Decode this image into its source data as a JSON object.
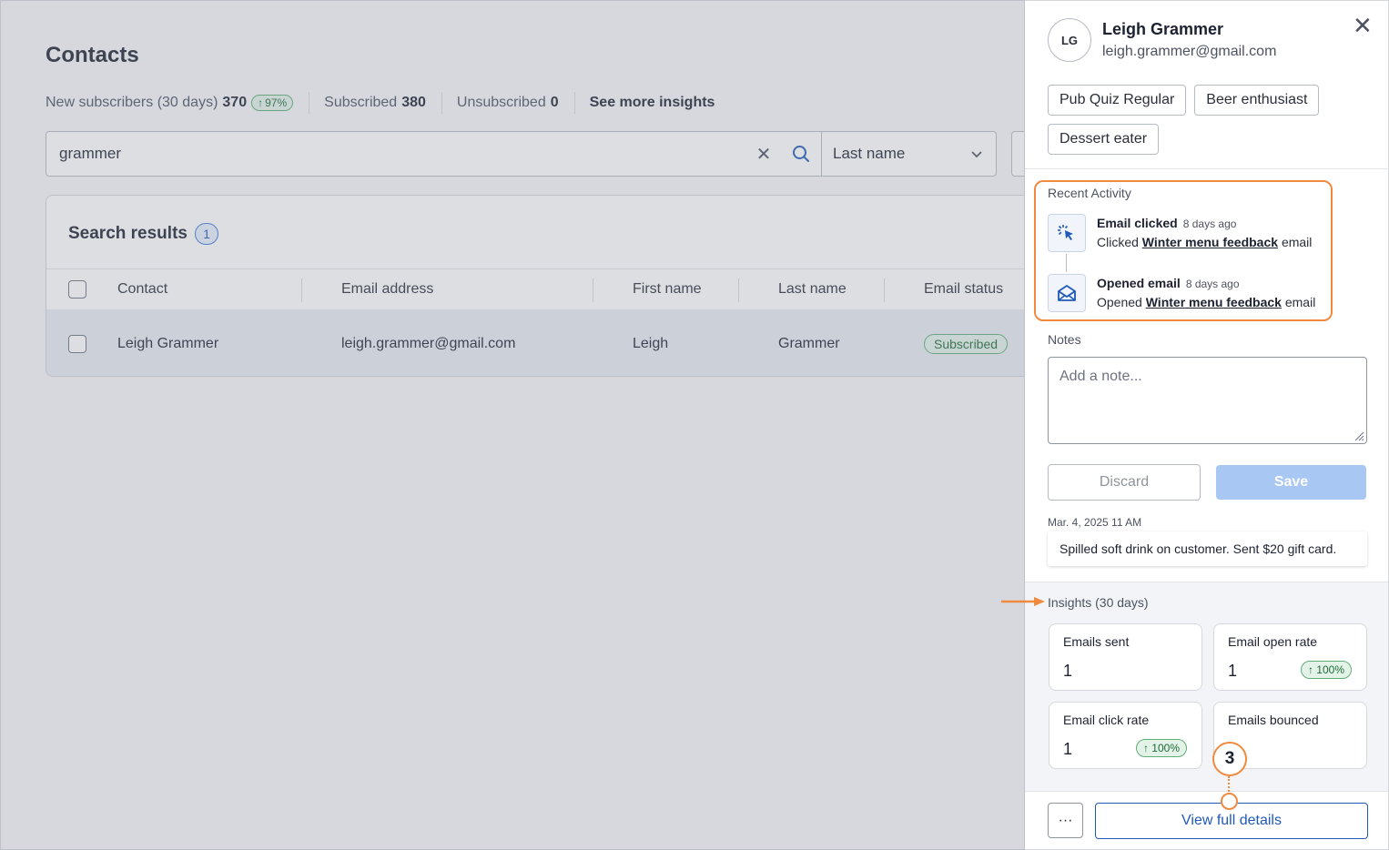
{
  "page": {
    "title": "Contacts",
    "stats": [
      {
        "label": "New subscribers (30 days)",
        "value": "370",
        "change": "97%"
      },
      {
        "label": "Subscribed",
        "value": "380"
      },
      {
        "label": "Unsubscribed",
        "value": "0"
      }
    ],
    "insights_link": "See more insights"
  },
  "search": {
    "value": "grammer",
    "filter_selected": "Last name"
  },
  "results": {
    "title": "Search results",
    "count": "1",
    "columns": [
      "Contact",
      "Email address",
      "First name",
      "Last name",
      "Email status"
    ],
    "rows": [
      {
        "contact": "Leigh Grammer",
        "email": "leigh.grammer@gmail.com",
        "first_name": "Leigh",
        "last_name": "Grammer",
        "status": "Subscribed"
      }
    ]
  },
  "panel": {
    "initials": "LG",
    "name": "Leigh Grammer",
    "email": "leigh.grammer@gmail.com",
    "tags": [
      "Pub Quiz Regular",
      "Beer enthusiast",
      "Dessert eater"
    ],
    "recent_activity": {
      "label": "Recent Activity",
      "items": [
        {
          "title": "Email clicked",
          "ago": "8 days ago",
          "prefix": "Clicked",
          "link": "Winter menu feedback",
          "suffix": "email",
          "icon": "cursor-click-icon"
        },
        {
          "title": "Opened email",
          "ago": "8 days ago",
          "prefix": "Opened",
          "link": "Winter menu feedback",
          "suffix": "email",
          "icon": "envelope-open-icon"
        }
      ]
    },
    "notes": {
      "label": "Notes",
      "placeholder": "Add a note...",
      "discard_label": "Discard",
      "save_label": "Save",
      "entries": [
        {
          "date": "Mar. 4, 2025 11 AM",
          "text": "Spilled soft drink on customer. Sent $20 gift card."
        }
      ]
    },
    "insights": {
      "label": "Insights (30 days)",
      "metrics": [
        {
          "label": "Emails sent",
          "value": "1",
          "change": ""
        },
        {
          "label": "Email open rate",
          "value": "1",
          "change": "100%"
        },
        {
          "label": "Email click rate",
          "value": "1",
          "change": "100%"
        },
        {
          "label": "Emails bounced",
          "value": "",
          "change": ""
        }
      ]
    },
    "more_label": "···",
    "view_details_label": "View full details"
  },
  "annotations": {
    "step": "3",
    "accent": "#f08a3e"
  },
  "colors": {
    "primary": "#2059b8",
    "success": "#1f6b3a",
    "save_disabled": "#a8c7f3"
  }
}
